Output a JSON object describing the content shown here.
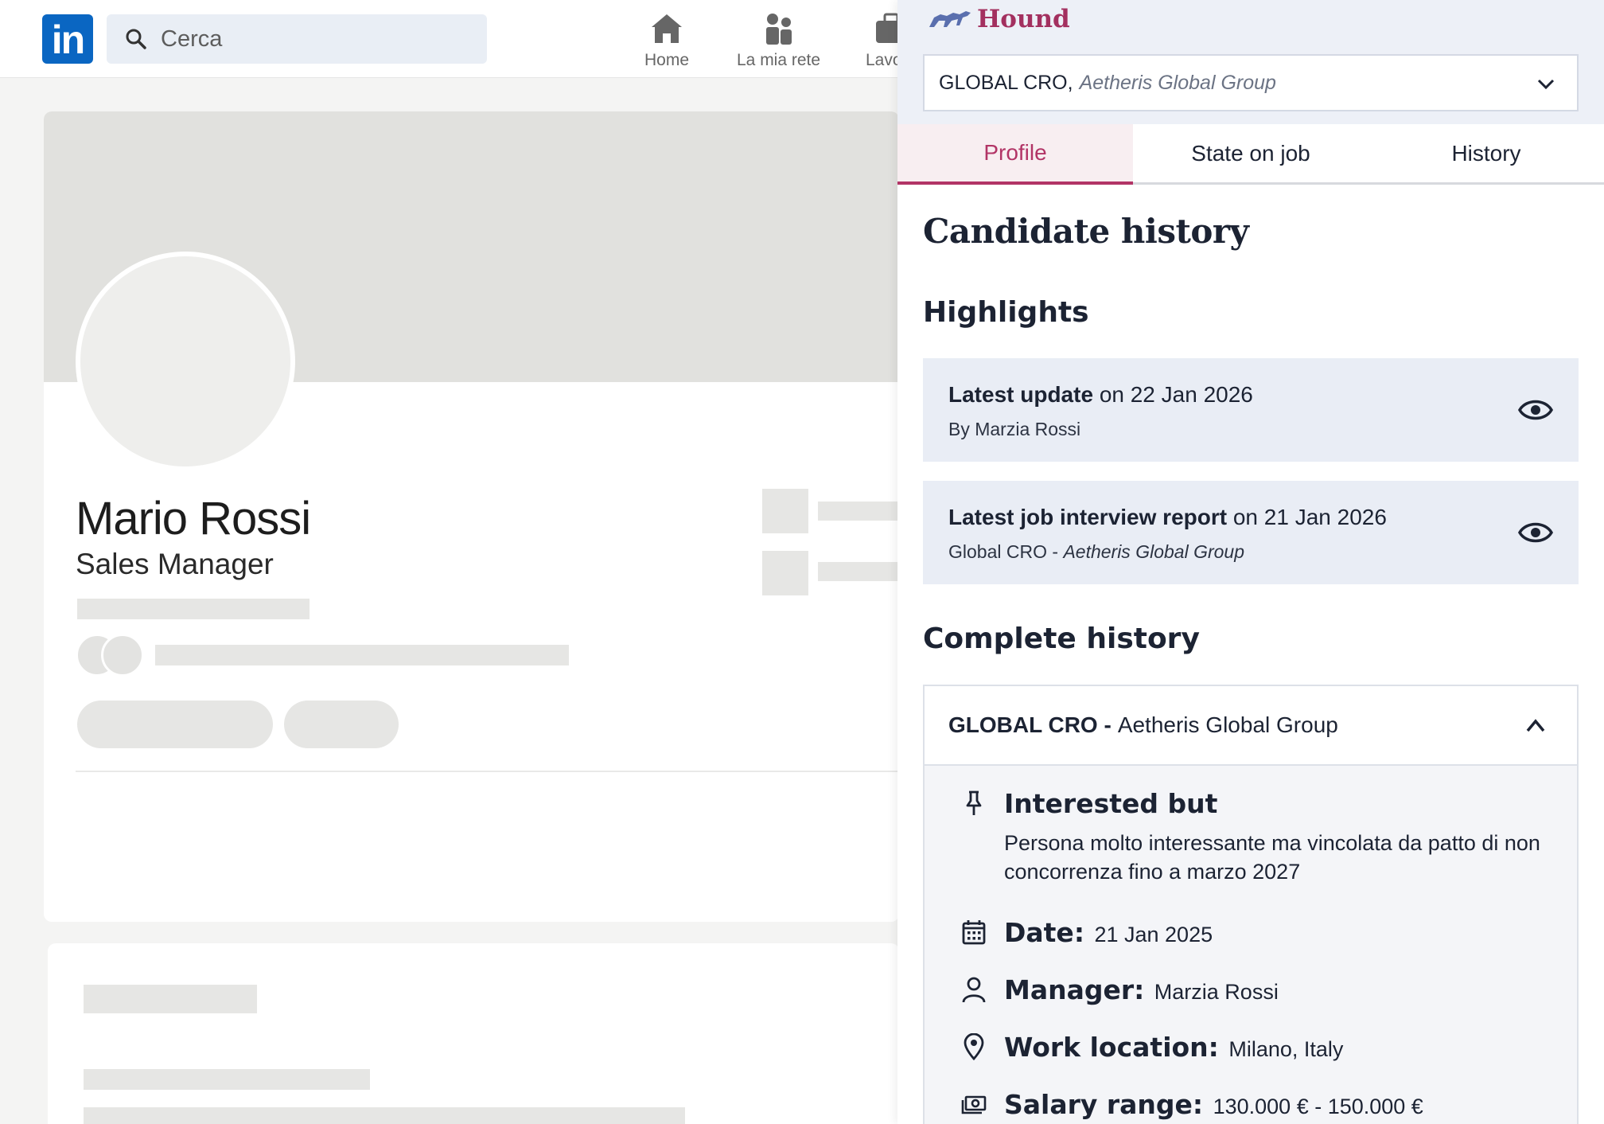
{
  "linkedin": {
    "logo_text": "in",
    "search_placeholder": "Cerca",
    "nav": [
      {
        "label": "Home",
        "icon": "home-icon"
      },
      {
        "label": "La mia rete",
        "icon": "network-icon"
      },
      {
        "label": "Lavoro",
        "icon": "briefcase-icon"
      }
    ],
    "profile": {
      "name": "Mario Rossi",
      "headline": "Sales Manager"
    }
  },
  "hound": {
    "brand": "Hound",
    "selector": {
      "role": "GLOBAL CRO,",
      "company": "Aetheris Global Group"
    },
    "tabs": [
      {
        "label": "Profile",
        "active": true
      },
      {
        "label": "State on job",
        "active": false
      },
      {
        "label": "History",
        "active": false
      }
    ],
    "title": "Candidate history",
    "highlights_heading": "Highlights",
    "highlights": [
      {
        "label": "Latest update",
        "date": "on 22 Jan 2026",
        "by": "By Marzia Rossi"
      },
      {
        "label": "Latest job interview report",
        "date": "on 21 Jan 2026",
        "sub_role": "Global CRO -",
        "sub_company": "Aetheris Global Group"
      }
    ],
    "complete_heading": "Complete history",
    "history": [
      {
        "role": "GLOBAL CRO -",
        "company": "Aetheris Global Group",
        "status": "Interested but",
        "note": "Persona molto interessante ma vincolata da patto di non concorrenza fino a marzo 2027",
        "date_label": "Date:",
        "date": "21 Jan 2025",
        "manager_label": "Manager:",
        "manager": "Marzia Rossi",
        "location_label": "Work location:",
        "location": "Milano, Italy",
        "salary_label": "Salary range:",
        "salary": "130.000 € - 150.000 €"
      }
    ],
    "colors": {
      "accent": "#b23466",
      "brand": "#a3305f",
      "card_bg": "#e9edf5",
      "top_bg": "#edf0f7"
    }
  }
}
